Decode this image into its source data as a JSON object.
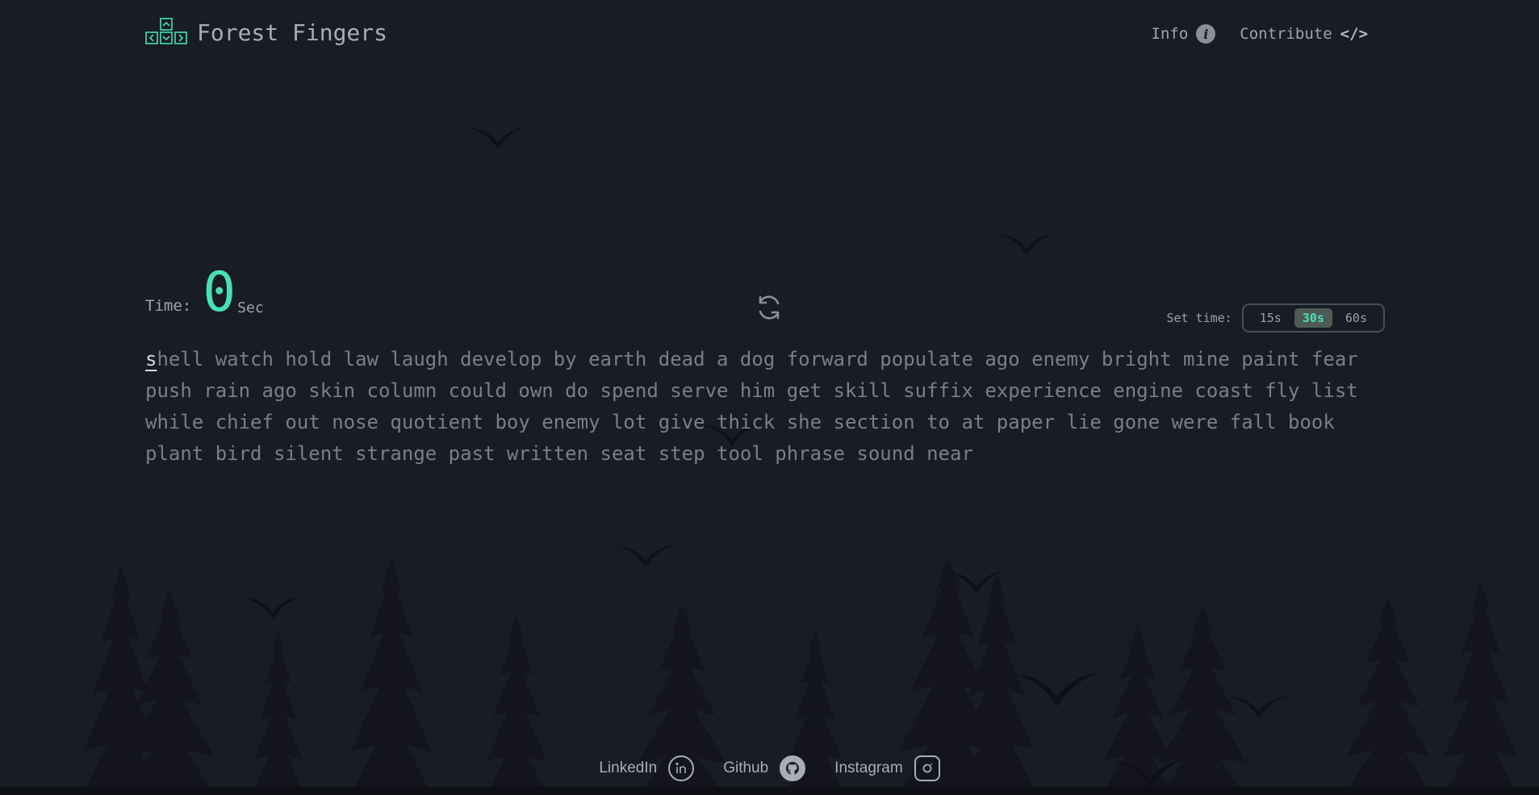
{
  "app": {
    "name": "Forest Fingers"
  },
  "nav": {
    "info_label": "Info",
    "contribute_label": "Contribute",
    "contribute_icon_text": "</>"
  },
  "timer": {
    "label": "Time:",
    "value": "0",
    "unit": "Sec"
  },
  "set_time": {
    "label": "Set time:",
    "options": [
      "15s",
      "30s",
      "60s"
    ],
    "selected": "30s"
  },
  "words": {
    "first_letter": "s",
    "rest": "hell watch hold law laugh develop by earth dead a dog forward populate ago enemy bright mine paint fear push rain ago skin column could own do spend serve him get skill suffix experience engine coast fly list while chief out nose quotient boy enemy lot give thick she section to at paper lie gone were fall book plant bird silent strange past written seat step tool phrase sound near"
  },
  "footer": {
    "linkedin": "LinkedIn",
    "github": "Github",
    "instagram": "Instagram"
  },
  "colors": {
    "accent": "#46e0b9",
    "background": "#181c24",
    "text": "#7a7f87"
  },
  "icons": [
    "keyboard-arrows-logo-icon",
    "info-icon",
    "code-icon",
    "refresh-icon",
    "linkedin-icon",
    "github-icon",
    "instagram-icon",
    "bird-icon",
    "pine-tree-icon"
  ]
}
